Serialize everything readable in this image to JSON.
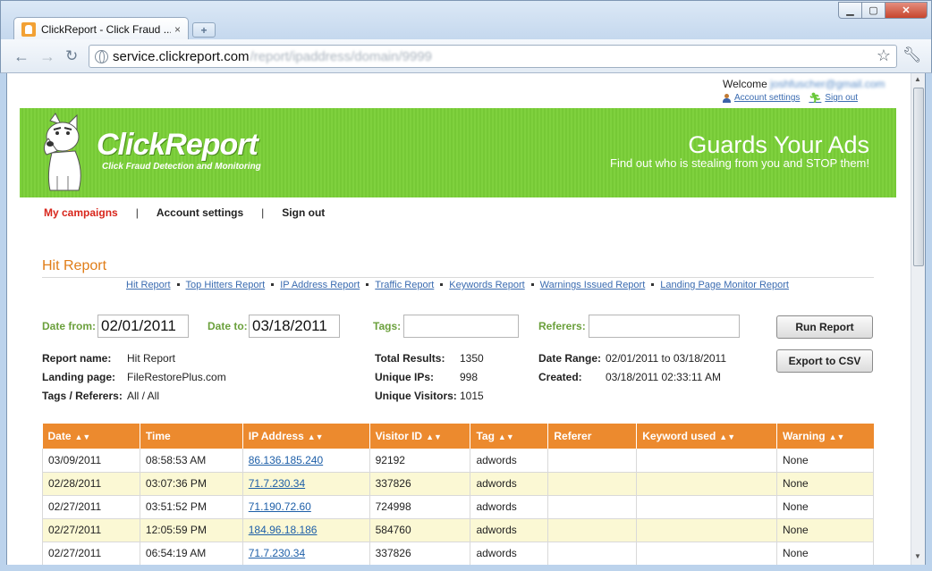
{
  "browser": {
    "tab_title": "ClickReport - Click Fraud ...",
    "tab_close": "×",
    "new_tab": "+",
    "url_host": "service.clickreport.com",
    "url_path": "/report/ipaddress/domain/9999"
  },
  "header": {
    "welcome_label": "Welcome",
    "user_email": "joshfuscher@gmail.com",
    "account_settings": "Account settings",
    "sign_out": "Sign out"
  },
  "banner": {
    "logo_text": "ClickReport",
    "tagline": "Click Fraud Detection and Monitoring",
    "headline": "Guards Your Ads",
    "subheadline": "Find out who is stealing from you and STOP them!"
  },
  "nav": {
    "my_campaigns": "My campaigns",
    "account_settings": "Account settings",
    "sign_out": "Sign out",
    "separator": "|"
  },
  "report": {
    "title": "Hit Report",
    "links": [
      "Hit Report",
      "Top Hitters Report",
      "IP Address Report",
      "Traffic Report",
      "Keywords Report",
      "Warnings Issued Report",
      "Landing Page Monitor Report"
    ]
  },
  "form": {
    "date_from_label": "Date from:",
    "date_from": "02/01/2011",
    "date_to_label": "Date to:",
    "date_to": "03/18/2011",
    "tags_label": "Tags:",
    "tags_value": "",
    "referers_label": "Referers:",
    "referers_value": "",
    "run_report": "Run Report",
    "export_csv": "Export to CSV"
  },
  "summary": {
    "report_name_label": "Report name:",
    "report_name": "Hit Report",
    "landing_page_label": "Landing page:",
    "landing_page": "FileRestorePlus.com",
    "tags_referers_label": "Tags / Referers:",
    "tags_referers": "All / All",
    "total_results_label": "Total Results:",
    "total_results": "1350",
    "unique_ips_label": "Unique IPs:",
    "unique_ips": "998",
    "unique_visitors_label": "Unique Visitors:",
    "unique_visitors": "1015",
    "date_range_label": "Date Range:",
    "date_range": "02/01/2011 to 03/18/2011",
    "created_label": "Created:",
    "created": "03/18/2011 02:33:11 AM"
  },
  "table": {
    "columns": [
      "Date",
      "Time",
      "IP Address",
      "Visitor ID",
      "Tag",
      "Referer",
      "Keyword used",
      "Warning"
    ],
    "sortable": [
      true,
      false,
      true,
      true,
      true,
      false,
      true,
      true
    ],
    "rows": [
      {
        "date": "03/09/2011",
        "time": "08:58:53 AM",
        "ip": "86.136.185.240",
        "visitor_id": "92192",
        "tag": "adwords",
        "referer": "",
        "keyword": "",
        "warning": "None"
      },
      {
        "date": "02/28/2011",
        "time": "03:07:36 PM",
        "ip": "71.7.230.34",
        "visitor_id": "337826",
        "tag": "adwords",
        "referer": "",
        "keyword": "",
        "warning": "None"
      },
      {
        "date": "02/27/2011",
        "time": "03:51:52 PM",
        "ip": "71.190.72.60",
        "visitor_id": "724998",
        "tag": "adwords",
        "referer": "",
        "keyword": "",
        "warning": "None"
      },
      {
        "date": "02/27/2011",
        "time": "12:05:59 PM",
        "ip": "184.96.18.186",
        "visitor_id": "584760",
        "tag": "adwords",
        "referer": "",
        "keyword": "",
        "warning": "None"
      },
      {
        "date": "02/27/2011",
        "time": "06:54:19 AM",
        "ip": "71.7.230.34",
        "visitor_id": "337826",
        "tag": "adwords",
        "referer": "",
        "keyword": "",
        "warning": "None"
      }
    ]
  },
  "colors": {
    "accent_orange": "#ec8a2e",
    "banner_green": "#7fd13e",
    "active_nav_red": "#d8261c",
    "label_green": "#6ba03c",
    "row_highlight": "#fbf8d4"
  },
  "icons": {
    "account": "person-icon",
    "signout": "running-man-icon",
    "sort": "sort-arrows-icon",
    "bookmark": "star-icon",
    "menu": "wrench-icon",
    "site": "globe-icon"
  }
}
